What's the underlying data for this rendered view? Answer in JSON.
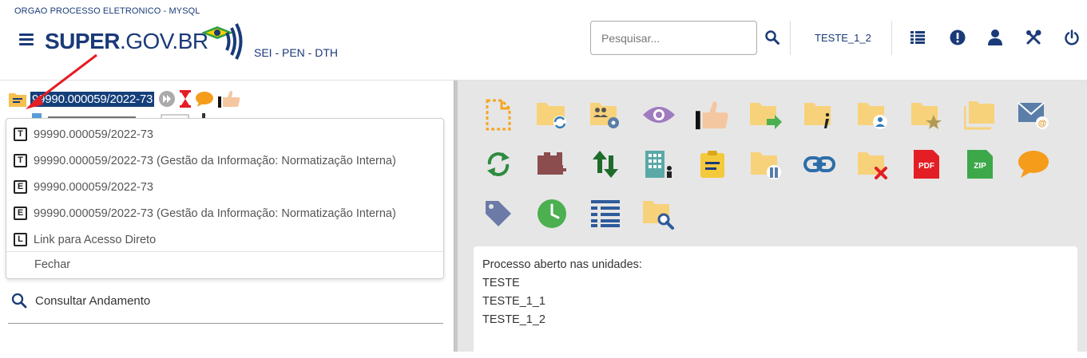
{
  "header": {
    "org_name": "ORGAO PROCESSO ELETRONICO - MYSQL",
    "logo_bold": "SUPER",
    "logo_light": ".GOV.BR",
    "subtitle": "SEI - PEN - DTH",
    "search_placeholder": "Pesquisar...",
    "unit": "TESTE_1_2",
    "icons": [
      "menu-icon",
      "search-icon",
      "list-icon",
      "alert-icon",
      "user-icon",
      "tools-icon",
      "power-icon"
    ]
  },
  "tree": {
    "process_number": "99990.000059/2022-73"
  },
  "menu": {
    "items": [
      {
        "badge": "T",
        "label": "99990.000059/2022-73"
      },
      {
        "badge": "T",
        "label": "99990.000059/2022-73 (Gestão da Informação: Normatização Interna)"
      },
      {
        "badge": "E",
        "label": "99990.000059/2022-73"
      },
      {
        "badge": "E",
        "label": "99990.000059/2022-73 (Gestão da Informação: Normatização Interna)"
      },
      {
        "badge": "L",
        "label": "Link para Acesso Direto"
      }
    ],
    "close_label": "Fechar"
  },
  "consult": {
    "label": "Consultar Andamento"
  },
  "action_icons": [
    "new-document-icon",
    "reopen-folder-icon",
    "assign-users-icon",
    "visualize-icon",
    "award-icon",
    "folder-send-icon",
    "folder-info-icon",
    "folder-user-icon",
    "folder-star-icon",
    "folders-icon",
    "email-icon",
    "sync-icon",
    "attach-block-icon",
    "swap-icon",
    "building-user-icon",
    "notes-icon",
    "folder-pause-icon",
    "link-icon",
    "folder-remove-icon",
    "pdf-icon",
    "zip-icon",
    "comment-icon",
    "tag-icon",
    "clock-icon",
    "list-view-icon",
    "folder-search-icon"
  ],
  "units_box": {
    "title": "Processo aberto nas unidades:",
    "units": [
      "TESTE",
      "TESTE_1_1",
      "TESTE_1_2"
    ]
  },
  "colors": {
    "brand": "#1a3a78",
    "selection": "#143f7a",
    "folder": "#f5c04f",
    "arrow": "#e31e24"
  }
}
